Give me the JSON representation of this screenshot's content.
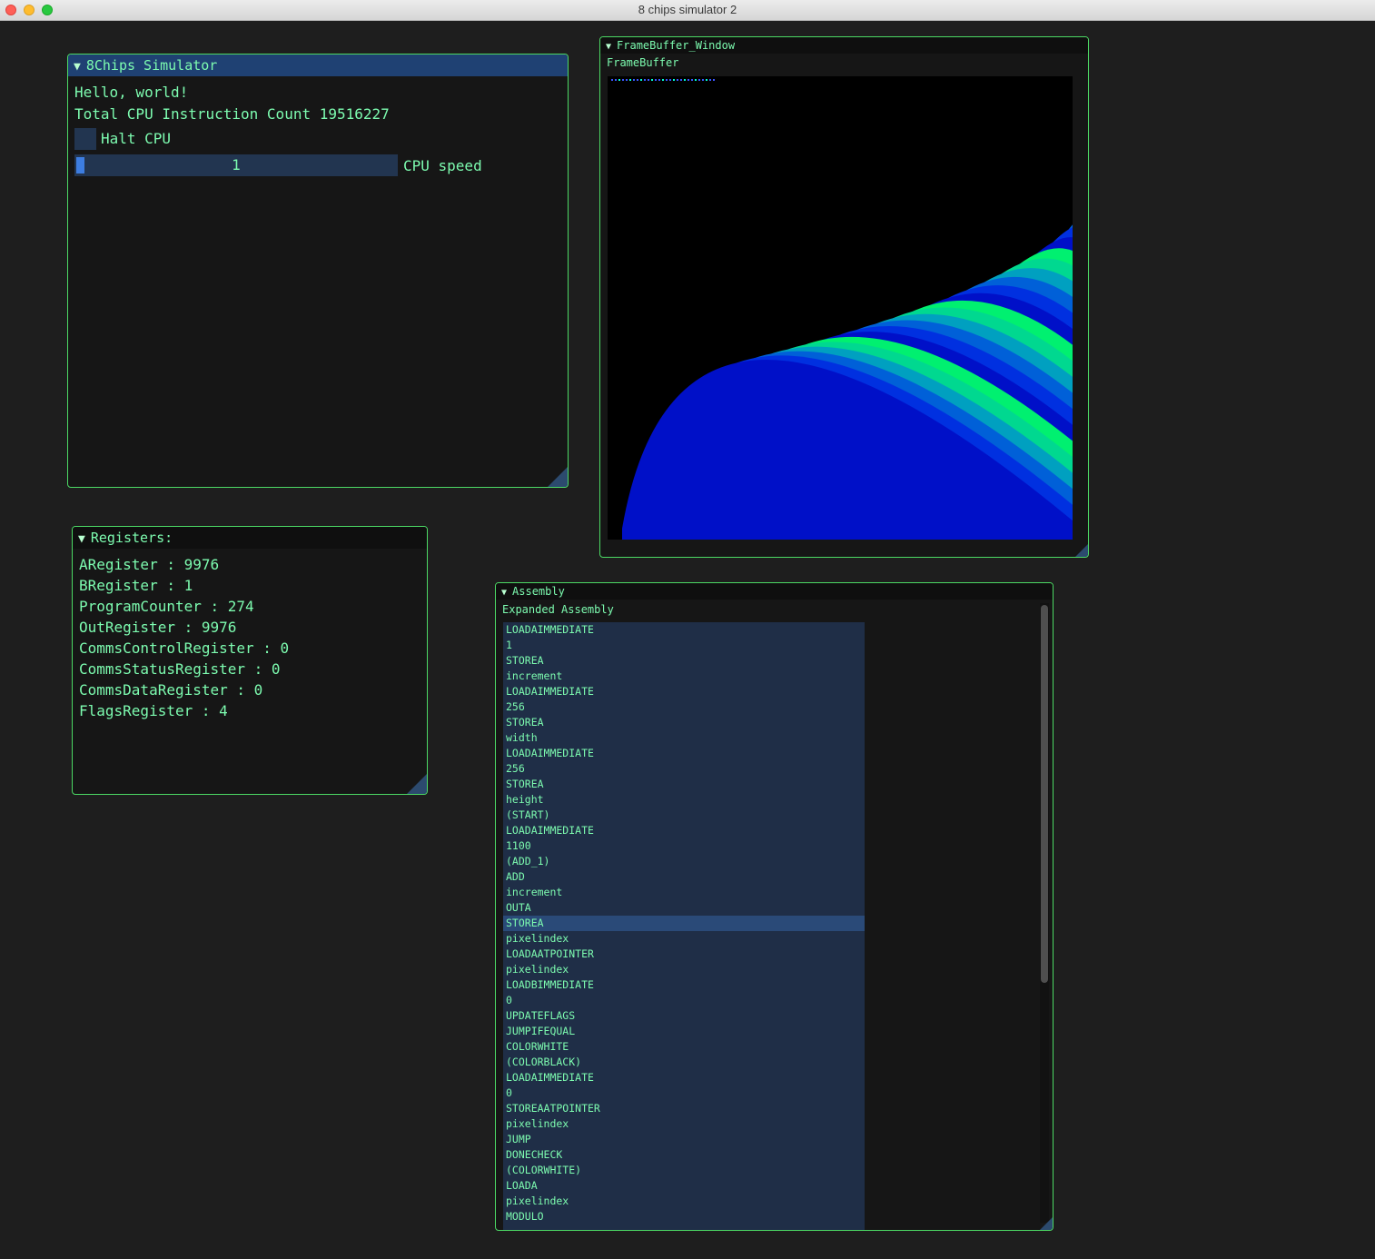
{
  "app": {
    "window_title": "8 chips simulator 2"
  },
  "simulator": {
    "title": "8Chips Simulator",
    "hello": "Hello, world!",
    "instruction_count": "Total CPU Instruction Count 19516227",
    "halt_label": "Halt CPU",
    "halt_checked": false,
    "speed_value": "1",
    "speed_label": "CPU speed"
  },
  "framebuffer": {
    "window_title": "FrameBuffer_Window",
    "label": "FrameBuffer"
  },
  "registers": {
    "title": "Registers:",
    "lines": [
      "ARegister : 9976",
      "BRegister : 1",
      "ProgramCounter : 274",
      "OutRegister : 9976",
      "CommsControlRegister : 0",
      "CommsStatusRegister : 0",
      "CommsDataRegister : 0",
      "FlagsRegister : 4"
    ]
  },
  "assembly": {
    "title": "Assembly",
    "label": "Expanded Assembly",
    "selected_index": 19,
    "items": [
      "LOADAIMMEDIATE",
      "1",
      "STOREA",
      "increment",
      "LOADAIMMEDIATE",
      "256",
      "STOREA",
      "width",
      "LOADAIMMEDIATE",
      "256",
      "STOREA",
      "height",
      "(START)",
      "LOADAIMMEDIATE",
      "1100",
      "(ADD_1)",
      "ADD",
      "increment",
      "OUTA",
      "STOREA",
      "pixelindex",
      "LOADAATPOINTER",
      "pixelindex",
      "LOADBIMMEDIATE",
      "0",
      "UPDATEFLAGS",
      "JUMPIFEQUAL",
      "COLORWHITE",
      "(COLORBLACK)",
      "LOADAIMMEDIATE",
      "0",
      "STOREAATPOINTER",
      "pixelindex",
      "JUMP",
      "DONECHECK",
      "(COLORWHITE)",
      "LOADA",
      "pixelindex",
      "MODULO"
    ]
  }
}
